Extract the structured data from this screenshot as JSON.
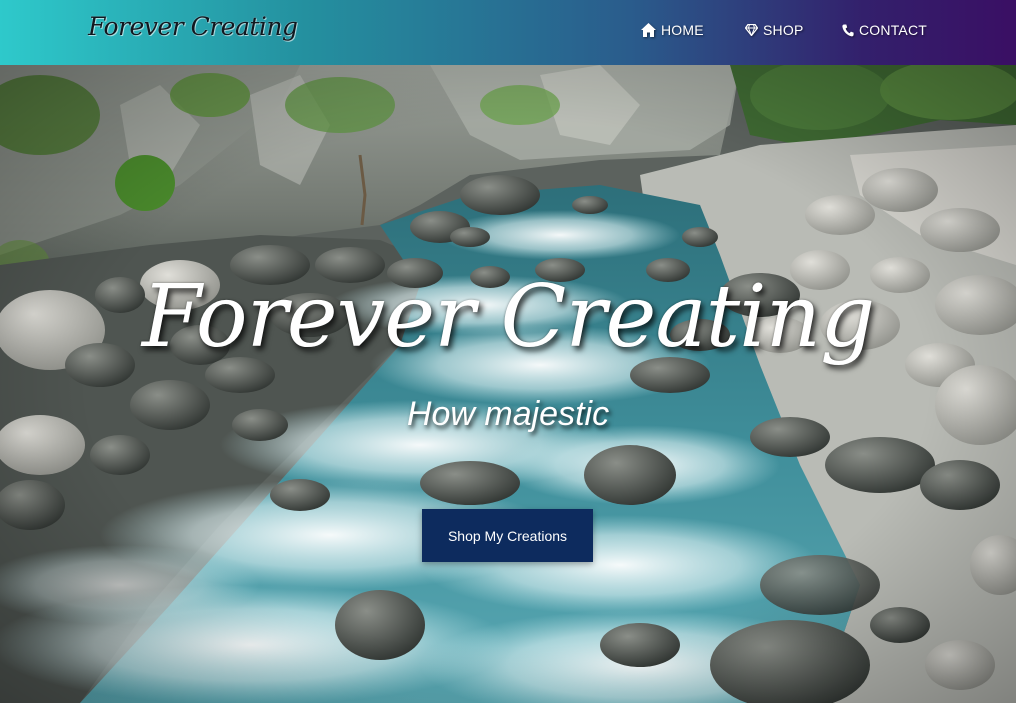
{
  "header": {
    "logo": "Forever Creating",
    "nav": [
      {
        "label": "HOME",
        "icon": "home-icon"
      },
      {
        "label": "SHOP",
        "icon": "diamond-icon"
      },
      {
        "label": "CONTACT",
        "icon": "phone-icon"
      }
    ]
  },
  "hero": {
    "title": "Forever Creating",
    "subtitle": "How majestic",
    "cta_label": "Shop My Creations"
  },
  "colors": {
    "header_gradient_start": "#2ec9cb",
    "header_gradient_end": "#3a0f64",
    "cta_background": "#0d2b5e",
    "text": "#ffffff"
  }
}
